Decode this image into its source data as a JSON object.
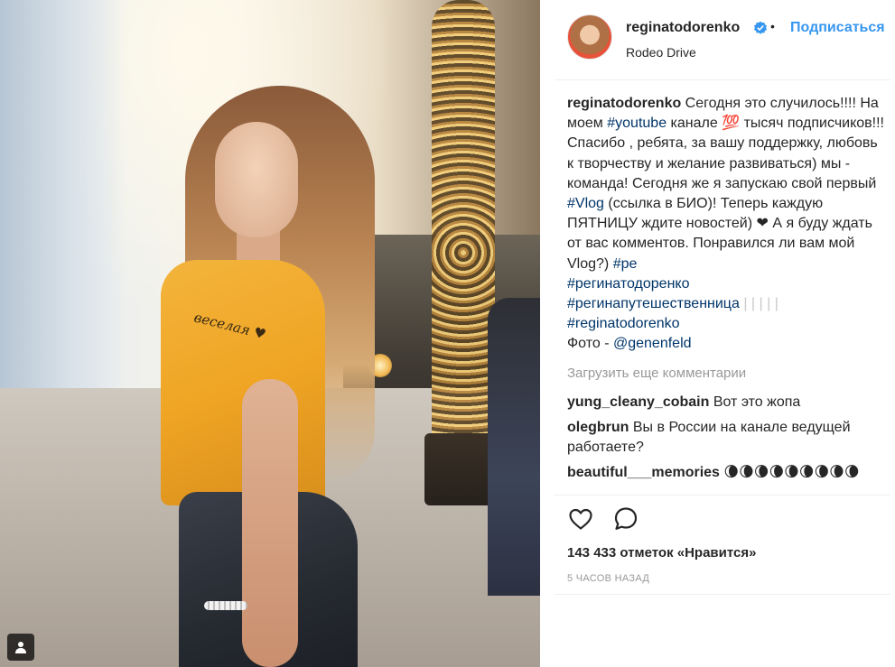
{
  "post": {
    "username": "reginatodorenko",
    "verified_icon": "verified-badge-icon",
    "separator": "•",
    "follow_label": "Подписаться",
    "location": "Rodeo Drive",
    "shirt_text": "веселая ♥",
    "tag_icon": "person-tag-icon"
  },
  "caption": {
    "username": "reginatodorenko",
    "t1": " Сегодня это случилось!!!! На моем ",
    "tag_youtube": "#youtube",
    "t2": " канале 💯 тысяч подписчиков!!! Спасибо , ребята, за вашу поддержку, любовь к творчеству и желание развиваться) мы - команда! Сегодня же я запускаю свой первый ",
    "tag_vlog": "#Vlog",
    "t3": " (ссылка в БИО)! Теперь каждую ПЯТНИЦУ ждите новостей) ❤ А я буду ждать от вас комментов. Понравился ли вам мой Vlog?) ",
    "tag_pe": "#ре",
    "tag_rt": "#регинатодоренко",
    "tag_rp": "#регинапутешественница",
    "bars": " | | | | |",
    "tag_rt2": "#reginatodorenko",
    "photo_label": "Фото - ",
    "photo_credit": "@genenfeld"
  },
  "load_more": "Загрузить еще комментарии",
  "comments": [
    {
      "username": "yung_cleany_cobain",
      "text": " Вот это жопа"
    },
    {
      "username": "olegbrun",
      "text": " Вы в России на канале ведущей работаете?"
    },
    {
      "username": "beautiful___memories",
      "text": " 🌘🌘🌘🌘🌘🌘🌘🌘🌘"
    }
  ],
  "actions": {
    "like_icon": "heart-icon",
    "comment_icon": "comment-bubble-icon"
  },
  "likes": "143 433 отметок «Нравится»",
  "timestamp": "5 ЧАСОВ НАЗАД"
}
